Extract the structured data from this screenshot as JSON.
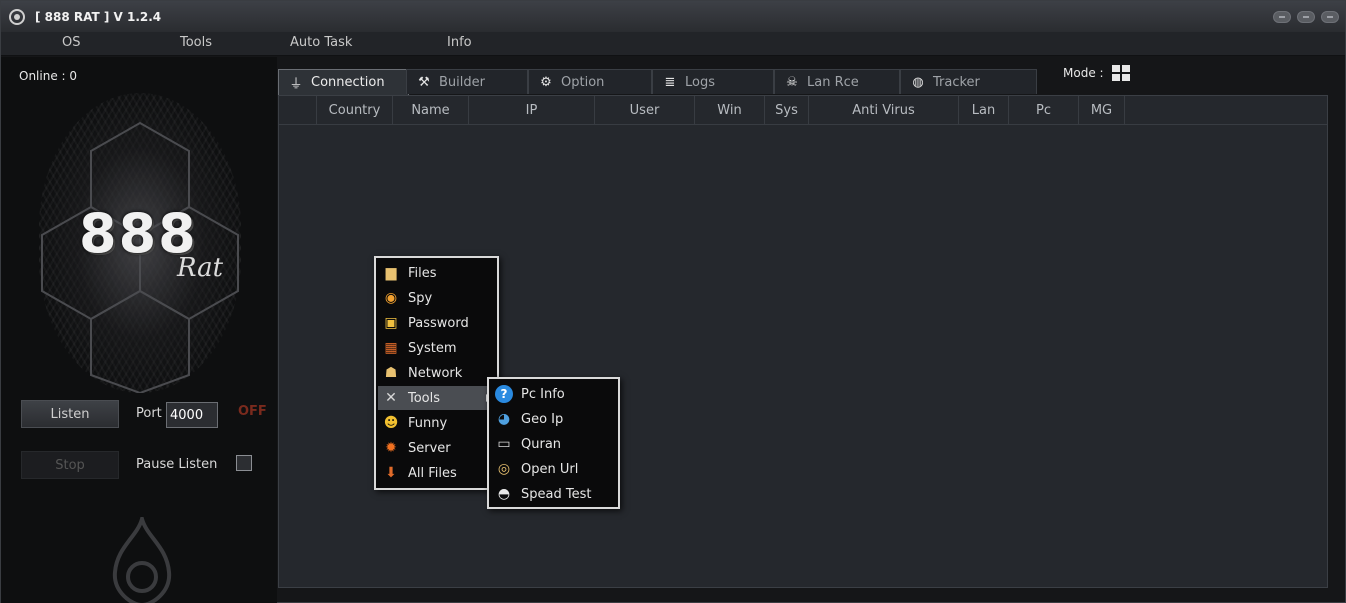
{
  "window": {
    "title": "[ 888 RAT ] V 1.2.4"
  },
  "menu": [
    "OS",
    "Tools",
    "Auto Task",
    "Info"
  ],
  "sidebar": {
    "online_label": "Online : 0",
    "logo_text": "888",
    "logo_subtext": "Rat",
    "listen_label": "Listen",
    "port_label": "Port",
    "port_value": "4000",
    "status_text": "OFF",
    "stop_label": "Stop",
    "pause_label": "Pause Listen"
  },
  "tabs": [
    {
      "label": "Connection",
      "icon": "plug-icon"
    },
    {
      "label": "Builder",
      "icon": "tools-icon"
    },
    {
      "label": "Option",
      "icon": "gear-icon"
    },
    {
      "label": "Logs",
      "icon": "database-icon"
    },
    {
      "label": "Lan Rce",
      "icon": "skull-icon"
    },
    {
      "label": "Tracker",
      "icon": "globe-icon"
    }
  ],
  "mode_label": "Mode :",
  "columns": [
    "Country",
    "Name",
    "IP",
    "User",
    "Win",
    "Sys",
    "Anti Virus",
    "Lan",
    "Pc",
    "MG"
  ],
  "context_menu": [
    {
      "label": "Files",
      "icon": "folder-icon"
    },
    {
      "label": "Spy",
      "icon": "eye-icon"
    },
    {
      "label": "Password",
      "icon": "lock-icon"
    },
    {
      "label": "System",
      "icon": "windows-icon"
    },
    {
      "label": "Network",
      "icon": "network-icon"
    },
    {
      "label": "Tools",
      "icon": "wrench-icon",
      "selected": true
    },
    {
      "label": "Funny",
      "icon": "smiley-icon"
    },
    {
      "label": "Server",
      "icon": "sun-icon"
    },
    {
      "label": "All Files",
      "icon": "download-icon"
    }
  ],
  "submenu": [
    {
      "label": "Pc Info",
      "icon": "help-icon"
    },
    {
      "label": "Geo Ip",
      "icon": "globe-icon"
    },
    {
      "label": "Quran",
      "icon": "book-icon"
    },
    {
      "label": "Open Url",
      "icon": "link-icon"
    },
    {
      "label": "Spead Test",
      "icon": "speedometer-icon"
    }
  ]
}
